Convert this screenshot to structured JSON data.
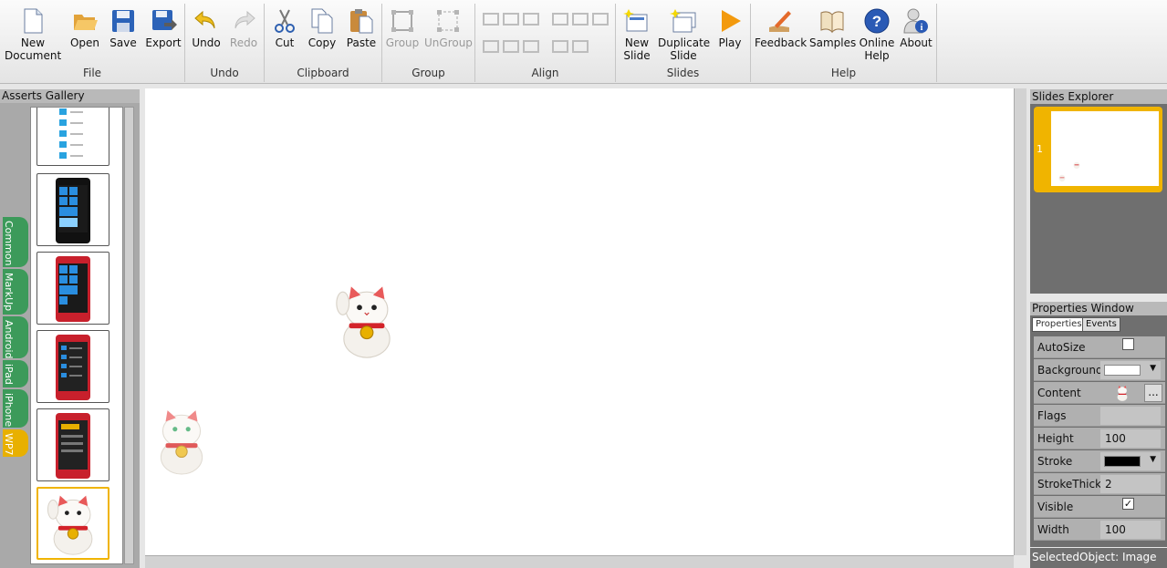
{
  "ribbon": {
    "groups": {
      "file": "File",
      "undo": "Undo",
      "clipboard": "Clipboard",
      "group": "Group",
      "align": "Align",
      "slides": "Slides",
      "help": "Help"
    },
    "buttons": {
      "new_document": "New\nDocument",
      "open": "Open",
      "save": "Save",
      "export": "Export",
      "undo": "Undo",
      "redo": "Redo",
      "cut": "Cut",
      "copy": "Copy",
      "paste": "Paste",
      "group": "Group",
      "ungroup": "UnGroup",
      "new_slide": "New\nSlide",
      "duplicate_slide": "Duplicate\nSlide",
      "play": "Play",
      "feedback": "Feedback",
      "samples": "Samples",
      "online_help": "Online\nHelp",
      "about": "About"
    }
  },
  "gallery": {
    "title": "Asserts Gallery",
    "tabs": [
      "Common",
      "MarkUp",
      "Android",
      "iPad",
      "iPhone",
      "WP7"
    ],
    "selected_tab": "WP7"
  },
  "slides": {
    "title": "Slides Explorer",
    "items": [
      {
        "number": "1"
      }
    ]
  },
  "properties": {
    "title": "Properties Window",
    "tabs": [
      "Properties",
      "Events"
    ],
    "rows": {
      "autosize": {
        "label": "AutoSize",
        "checked": false
      },
      "background": {
        "label": "Background",
        "color": "#ffffff"
      },
      "content": {
        "label": "Content",
        "button": "..."
      },
      "flags": {
        "label": "Flags",
        "value": ""
      },
      "height": {
        "label": "Height",
        "value": "100"
      },
      "stroke": {
        "label": "Stroke",
        "color": "#000000"
      },
      "strokethick": {
        "label": "StrokeThick",
        "value": "2"
      },
      "visible": {
        "label": "Visible",
        "checked": true
      },
      "width": {
        "label": "Width",
        "value": "100"
      }
    }
  },
  "status": {
    "selected_object": "SelectedObject: Image"
  },
  "colors": {
    "accent": "#f0b400",
    "tab_green": "#3c9a5a",
    "panel_dark": "#6f6f6f"
  }
}
